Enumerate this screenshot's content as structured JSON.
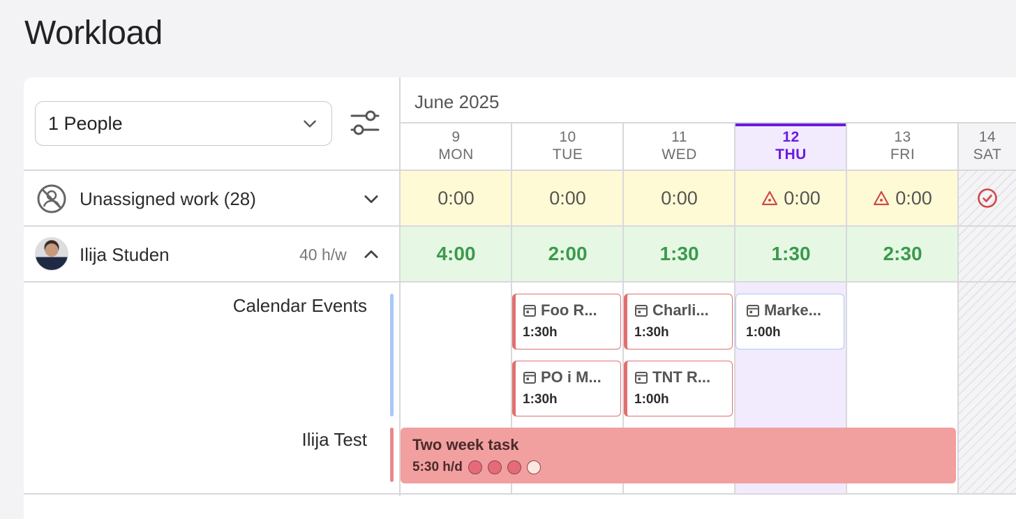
{
  "page": {
    "title": "Workload"
  },
  "filter": {
    "people_label": "1 People"
  },
  "calendar": {
    "month_label": "June 2025",
    "days": [
      {
        "num": "9",
        "name": "MON"
      },
      {
        "num": "10",
        "name": "TUE"
      },
      {
        "num": "11",
        "name": "WED"
      },
      {
        "num": "12",
        "name": "THU"
      },
      {
        "num": "13",
        "name": "FRI"
      },
      {
        "num": "14",
        "name": "SAT"
      }
    ]
  },
  "unassigned": {
    "label": "Unassigned work (28)",
    "values": [
      "0:00",
      "0:00",
      "0:00",
      "0:00",
      "0:00"
    ]
  },
  "person": {
    "name": "Ilija Studen",
    "capacity": "40 h/w",
    "values": [
      "4:00",
      "2:00",
      "1:30",
      "1:30",
      "2:30"
    ]
  },
  "sections": {
    "calendar_events": "Calendar Events",
    "ilija_test": "Ilija Test"
  },
  "events": [
    {
      "title": "Foo R...",
      "duration": "1:30h"
    },
    {
      "title": "Charli...",
      "duration": "1:30h"
    },
    {
      "title": "Marke...",
      "duration": "1:00h"
    },
    {
      "title": "PO i M...",
      "duration": "1:30h"
    },
    {
      "title": "TNT R...",
      "duration": "1:00h"
    }
  ],
  "task": {
    "title": "Two week task",
    "rate": "5:30 h/d",
    "progress_filled": 3,
    "progress_total": 4
  },
  "colors": {
    "accent": "#6a1be0",
    "hours_green": "#3b9a4c",
    "event_red": "#e07070",
    "event_blue": "#a9c8f5",
    "task_bg": "#f29fa0"
  }
}
